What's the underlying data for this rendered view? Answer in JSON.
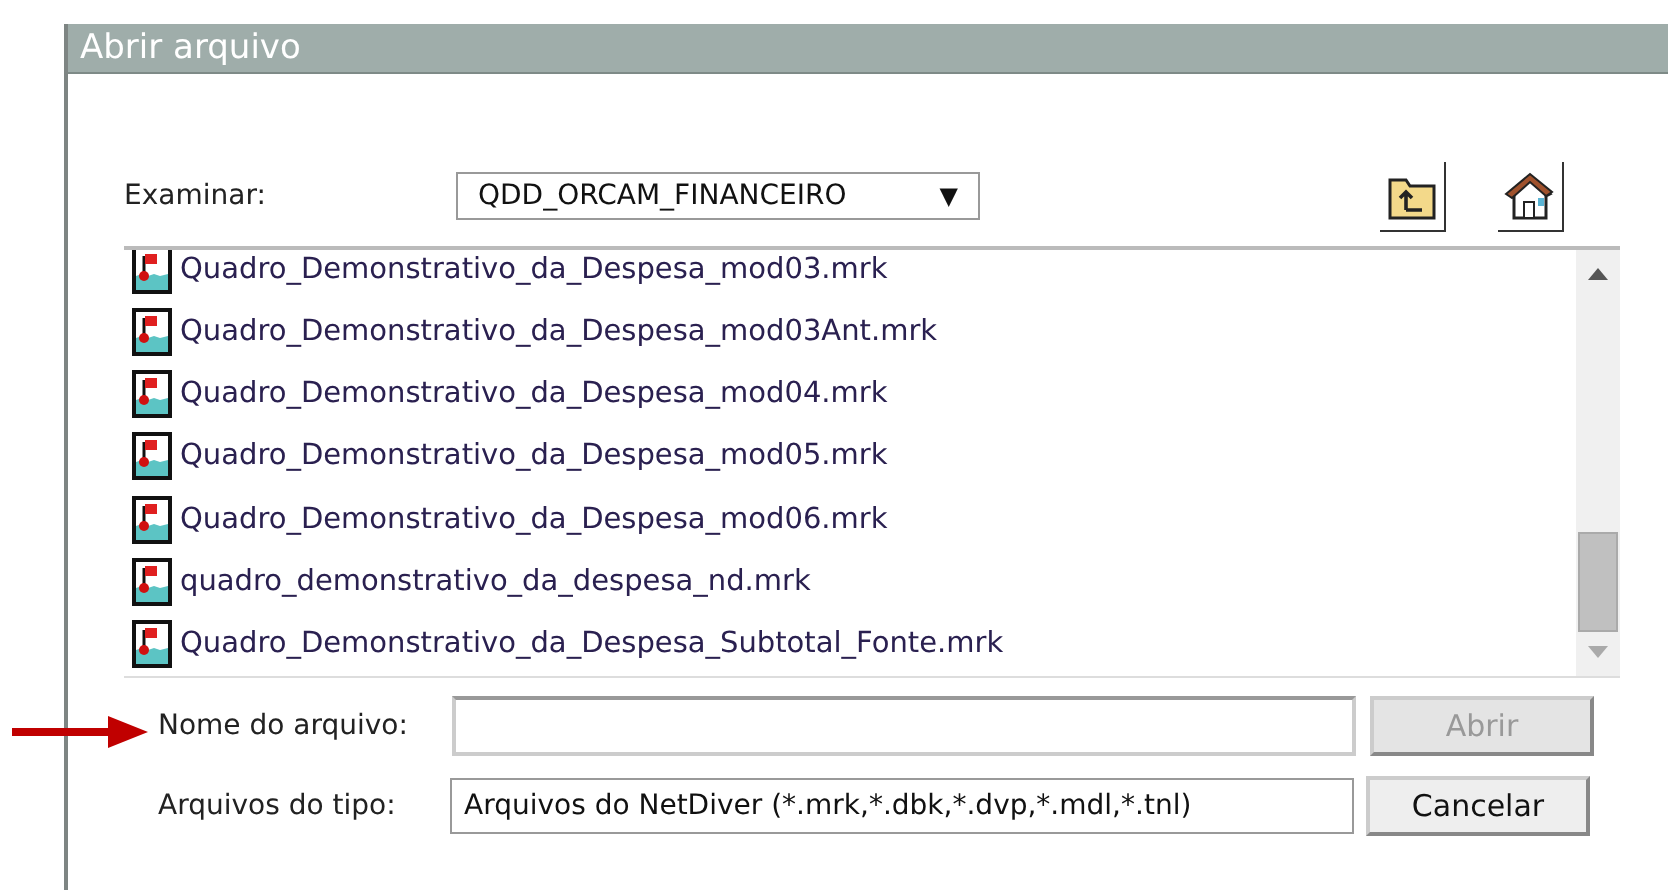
{
  "window": {
    "title": "Abrir arquivo"
  },
  "look_in": {
    "label": "Examinar:",
    "value": "QDD_ORCAM_FINANCEIRO",
    "caret": "▼"
  },
  "files": [
    {
      "name": "Quadro_Demonstrativo_da_Despesa_mod03.mrk",
      "selected": false
    },
    {
      "name": "Quadro_Demonstrativo_da_Despesa_mod03Ant.mrk",
      "selected": false
    },
    {
      "name": "Quadro_Demonstrativo_da_Despesa_mod04.mrk",
      "selected": false
    },
    {
      "name": "Quadro_Demonstrativo_da_Despesa_mod05.mrk",
      "selected": false
    },
    {
      "name": "Quadro_Demonstrativo_da_Despesa_mod06.mrk",
      "selected": false
    },
    {
      "name": "quadro_demonstrativo_da_despesa_nd.mrk",
      "selected": false
    },
    {
      "name": "Quadro_Demonstrativo_da_Despesa_Subtotal_Fonte.mrk",
      "selected": false
    }
  ],
  "file_name": {
    "label": "Nome do arquivo:"
  },
  "file_type": {
    "label": "Arquivos do tipo:",
    "value": "Arquivos do NetDiver (*.mrk,*.dbk,*.dvp,*.mdl,*.tnl)"
  },
  "buttons": [
    {
      "label": "Abrir",
      "disabled": true
    },
    {
      "label": "Cancelar",
      "disabled": false
    }
  ]
}
